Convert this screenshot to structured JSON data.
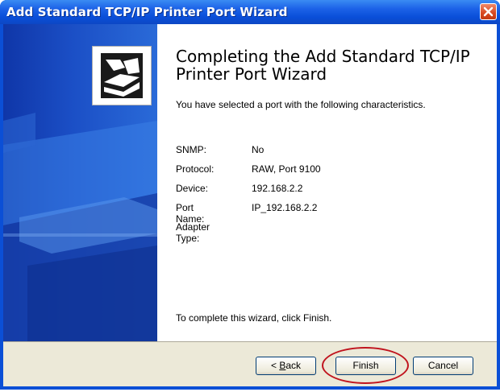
{
  "window": {
    "title": "Add Standard TCP/IP Printer Port Wizard"
  },
  "icons": {
    "close": "close-icon",
    "wizard": "printer-wizard-icon"
  },
  "content": {
    "heading": "Completing the Add Standard TCP/IP Printer Port Wizard",
    "intro": "You have selected a port with the following characteristics.",
    "properties": [
      {
        "label": "SNMP:",
        "value": "No"
      },
      {
        "label": "Protocol:",
        "value": "RAW, Port 9100"
      },
      {
        "label": "Device:",
        "value": "192.168.2.2"
      },
      {
        "label": "Port Name:",
        "value": "IP_192.168.2.2"
      },
      {
        "label": "Adapter Type:",
        "value": ""
      }
    ],
    "complete_text": "To complete this wizard, click Finish."
  },
  "buttons": {
    "back_accel": "B",
    "back_rest": "ack",
    "back_prefix": "< ",
    "finish": "Finish",
    "cancel": "Cancel"
  },
  "colors": {
    "title_bar": "#0a4fd9",
    "side_panel": "#1b4fc6",
    "highlight": "#c0141e"
  }
}
